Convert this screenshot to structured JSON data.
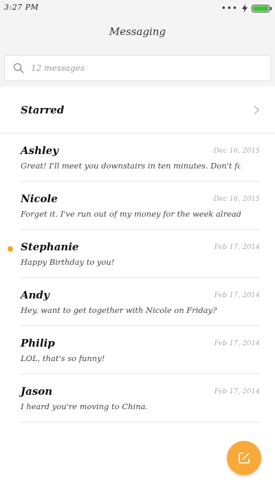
{
  "status_bar": {
    "time": "3:27 PM",
    "signal_dots": "•••",
    "battery_level": 1.0,
    "battery_color": "#3fbf3a"
  },
  "header": {
    "title": "Messaging"
  },
  "search": {
    "placeholder": "12 messages"
  },
  "starred": {
    "label": "Starred"
  },
  "conversations": [
    {
      "name": "Ashley",
      "date": "Dec 16, 2015",
      "snippet": "Great! I'll meet you downstairs in ten minutes. Don't forge",
      "unread": false
    },
    {
      "name": "Nicole",
      "date": "Dec 16, 2015",
      "snippet": "Forget it. I've run out of my money for the week already.",
      "unread": false
    },
    {
      "name": "Stephanie",
      "date": "Feb 17, 2014",
      "snippet": "Happy Birthday to you!",
      "unread": true
    },
    {
      "name": "Andy",
      "date": "Feb 17, 2014",
      "snippet": "Hey, want to get together with Nicole on Friday?",
      "unread": false
    },
    {
      "name": "Philip",
      "date": "Feb 17, 2014",
      "snippet": "LOL, that's so funny!",
      "unread": false
    },
    {
      "name": "Jason",
      "date": "Feb 17, 2014",
      "snippet": "I heard you're moving to China.",
      "unread": false
    }
  ],
  "colors": {
    "accent": "#f7a93a",
    "unread_dot": "#f5a623"
  },
  "icons": {
    "compose": "compose-icon",
    "search": "search-icon",
    "chevron": "chevron-right-icon"
  }
}
